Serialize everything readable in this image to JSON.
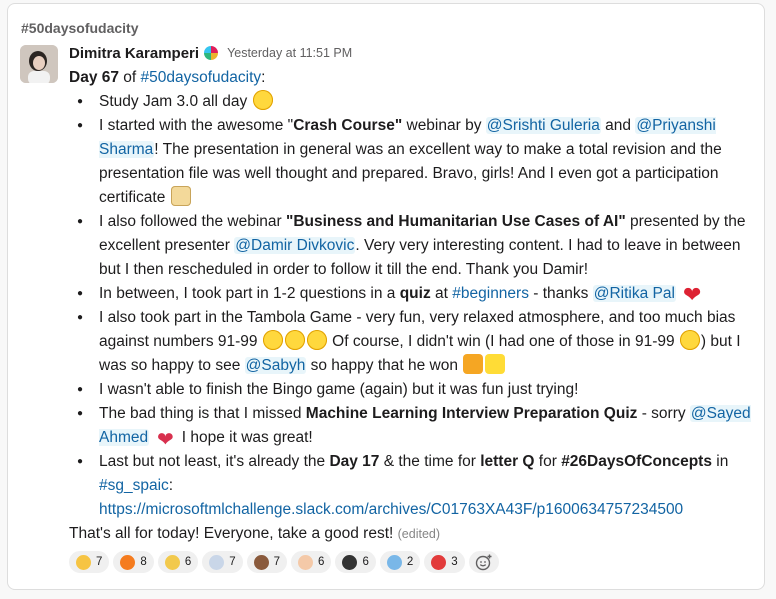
{
  "channel": "#50daysofudacity",
  "author": {
    "name": "Dimitra Karamperi",
    "badge_icon": "udacity-badge-icon"
  },
  "timestamp": "Yesterday at 11:51 PM",
  "message": {
    "intro_day": "Day 67",
    "intro_of": " of ",
    "intro_tag": "#50daysofudacity",
    "intro_colon": ":",
    "items": [
      {
        "text": "Study Jam 3.0 all day ",
        "emoji": "star-struck-emoji"
      },
      {
        "p1": "I started with the awesome \"",
        "bold1": "Crash Course\"",
        "p2": " webinar by ",
        "mention1": "@Srishti Guleria",
        "p3": " and ",
        "mention2": "@Priyanshi Sharma",
        "p4": "! The presentation in general was an excellent way to make a total revision and the presentation file was well thought and prepared. Bravo, girls! And I even got a participation certificate ",
        "emoji": "diploma-emoji"
      },
      {
        "p1": "I also followed the webinar ",
        "bold1": "\"Business and Humanitarian Use Cases of AI\"",
        "p2": " presented by the excellent presenter ",
        "mention1": "@Damir Divkovic",
        "p3": ". Very very interesting content. I had to leave in between but I then rescheduled in order to follow it till the end. Thank you Damir!"
      },
      {
        "p1": "In between, I took part in 1-2 questions in a ",
        "bold1": "quiz",
        "p2": " at ",
        "tag1": "#beginners",
        "p3": " - thanks ",
        "mention1": "@Ritika Pal",
        "emoji": "red-heart-emoji"
      },
      {
        "p1": "I also took part in the Tambola Game - very fun, very relaxed atmosphere, and too much bias against numbers 91-99 ",
        "p2": " Of course, I didn't win (I had one of those in 91-99 ",
        "p3": ") but I was so happy to see ",
        "mention1": "@Sabyh",
        "p4": " so happy that he won "
      },
      {
        "text": "I wasn't able to finish the Bingo game (again) but it was fun just trying!"
      },
      {
        "p1": "The bad thing is that I missed ",
        "bold1": "Machine Learning Interview Preparation Quiz",
        "p2": " - sorry ",
        "mention1": "@Sayed Ahmed",
        "p3": " I hope it was great!"
      },
      {
        "p1": "Last but not least, it's already the ",
        "bold1": "Day 17",
        "p2": " & the time for ",
        "bold2": "letter Q",
        "p3": " for ",
        "bold3": "#26DaysOfConcepts",
        "p4": " in ",
        "tag1": "#sg_spaic",
        "p5": ":",
        "url": "https://microsoftmlchallenge.slack.com/archives/C01763XA43F/p1600634757234500"
      }
    ],
    "outro": "That's all for today! Everyone, take a good rest! ",
    "edited": "(edited)"
  },
  "reactions": [
    {
      "icon": "raised-hands-icon",
      "count": "7",
      "color": "#f6c443"
    },
    {
      "icon": "fire-icon",
      "count": "8",
      "color": "#f57c1f"
    },
    {
      "icon": "clapping-yellow-icon",
      "count": "6",
      "color": "#f2c94c"
    },
    {
      "icon": "rocket-icon",
      "count": "7",
      "color": "#c9d6e8"
    },
    {
      "icon": "thumbs-up-brown-icon",
      "count": "7",
      "color": "#8a5a3c"
    },
    {
      "icon": "clap-icon",
      "count": "6",
      "color": "#f4c9a8"
    },
    {
      "icon": "penguin-icon",
      "count": "6",
      "color": "#333333"
    },
    {
      "icon": "thank-you-icon",
      "count": "2",
      "color": "#79b7e8"
    },
    {
      "icon": "alert-icon",
      "count": "3",
      "color": "#e23b3b"
    }
  ]
}
